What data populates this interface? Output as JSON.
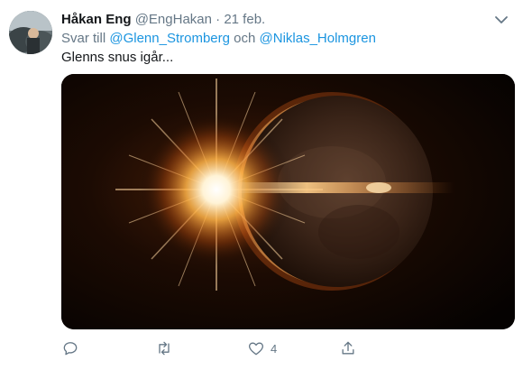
{
  "tweet": {
    "author_name": "Håkan Eng",
    "author_handle": "@EngHakan",
    "separator": "·",
    "date": "21 feb.",
    "reply_prefix": "Svar till",
    "reply_mention_1": "@Glenn_Stromberg",
    "reply_conjunction": "och",
    "reply_mention_2": "@Niklas_Holmgren",
    "text": "Glenns snus igår..."
  },
  "actions": {
    "reply_count": "",
    "retweet_count": "",
    "like_count": "4"
  },
  "icons": {
    "menu": "chevron-down-icon",
    "reply": "reply-icon",
    "retweet": "retweet-icon",
    "like": "heart-icon",
    "share": "share-icon"
  },
  "colors": {
    "name": "#14171a",
    "muted": "#657786",
    "link": "#1b95e0"
  }
}
